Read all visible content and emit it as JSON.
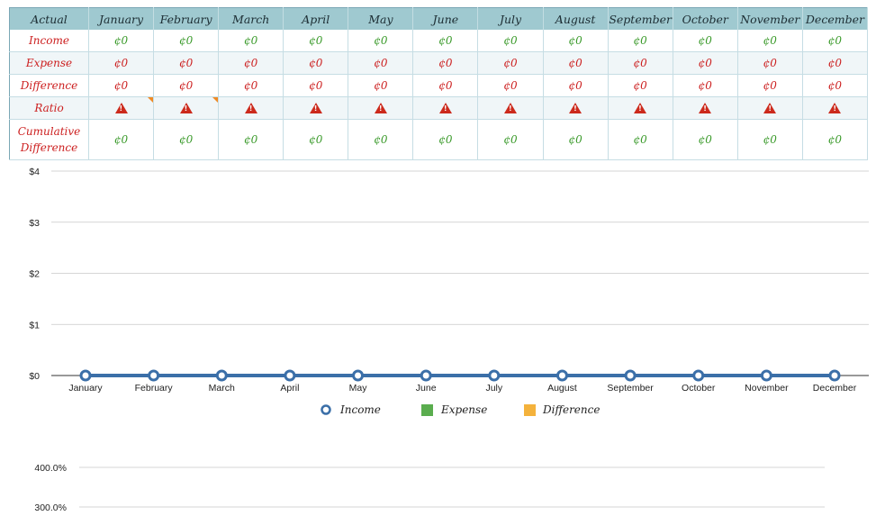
{
  "table": {
    "header_label": "Actual",
    "months": [
      "January",
      "February",
      "March",
      "April",
      "May",
      "June",
      "July",
      "August",
      "September",
      "October",
      "November",
      "December"
    ],
    "rows": [
      {
        "label": "Income",
        "tone": "pos",
        "values": [
          "¢0",
          "¢0",
          "¢0",
          "¢0",
          "¢0",
          "¢0",
          "¢0",
          "¢0",
          "¢0",
          "¢0",
          "¢0",
          "¢0"
        ]
      },
      {
        "label": "Expense",
        "tone": "neg",
        "values": [
          "¢0",
          "¢0",
          "¢0",
          "¢0",
          "¢0",
          "¢0",
          "¢0",
          "¢0",
          "¢0",
          "¢0",
          "¢0",
          "¢0"
        ]
      },
      {
        "label": "Difference",
        "tone": "neg",
        "values": [
          "¢0",
          "¢0",
          "¢0",
          "¢0",
          "¢0",
          "¢0",
          "¢0",
          "¢0",
          "¢0",
          "¢0",
          "¢0",
          "¢0"
        ]
      },
      {
        "label": "Ratio",
        "tone": "warn",
        "values": [
          "warning",
          "warning",
          "warning",
          "warning",
          "warning",
          "warning",
          "warning",
          "warning",
          "warning",
          "warning",
          "warning",
          "warning"
        ]
      },
      {
        "label": "Cumulative Difference",
        "tone": "pos",
        "values": [
          "¢0",
          "¢0",
          "¢0",
          "¢0",
          "¢0",
          "¢0",
          "¢0",
          "¢0",
          "¢0",
          "¢0",
          "¢0",
          "¢0"
        ]
      }
    ],
    "comment_flags": [
      "January",
      "February"
    ]
  },
  "colors": {
    "income": "#3b6fa8",
    "expense": "#5aad4e",
    "difference": "#f4b23c",
    "header_bg": "#9fc9d0"
  },
  "chart_data": [
    {
      "type": "line",
      "categories": [
        "January",
        "February",
        "March",
        "April",
        "May",
        "June",
        "July",
        "August",
        "September",
        "October",
        "November",
        "December"
      ],
      "series": [
        {
          "name": "Income",
          "values": [
            0,
            0,
            0,
            0,
            0,
            0,
            0,
            0,
            0,
            0,
            0,
            0
          ]
        },
        {
          "name": "Expense",
          "values": [
            0,
            0,
            0,
            0,
            0,
            0,
            0,
            0,
            0,
            0,
            0,
            0
          ]
        },
        {
          "name": "Difference",
          "values": [
            0,
            0,
            0,
            0,
            0,
            0,
            0,
            0,
            0,
            0,
            0,
            0
          ]
        }
      ],
      "y_ticks": [
        "$0",
        "$1",
        "$2",
        "$3",
        "$4"
      ],
      "ylim": [
        0,
        4
      ],
      "grid": true,
      "legend": "bottom"
    },
    {
      "type": "line",
      "y_ticks": [
        "300.0%",
        "400.0%"
      ],
      "visible_range": [
        300,
        400
      ],
      "grid": true
    }
  ]
}
